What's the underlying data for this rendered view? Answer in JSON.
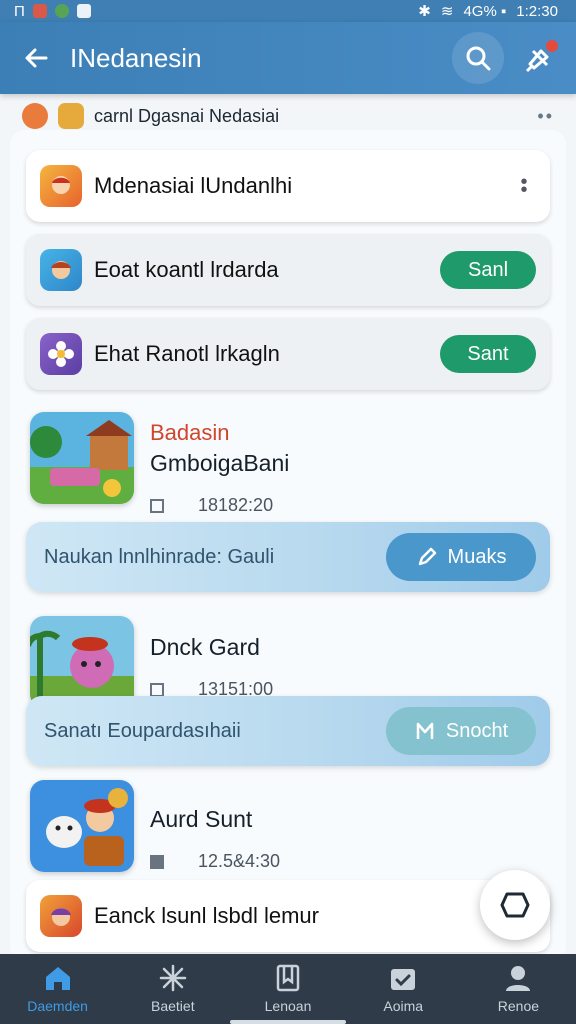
{
  "status_bar": {
    "left_text": "Π",
    "right_text": "4G% ▪",
    "time": "1:2:30"
  },
  "app_bar": {
    "title": "INedanesin",
    "icons": [
      "back-arrow-icon",
      "search-icon",
      "notification-icon"
    ]
  },
  "header": {
    "text": "carnl Dgasnai Nedasiai"
  },
  "list_cards": [
    {
      "title": "Mdenasiai lUndanlhi",
      "action": "menu"
    },
    {
      "title": "Eoat koantl lrdarda",
      "button": "Sanl"
    },
    {
      "title": "Ehat Ranotl lrkagln",
      "button": "Sant"
    }
  ],
  "features": [
    {
      "badge": "Badasin",
      "title": "GmboigaBani",
      "meta": "18182:20"
    },
    {
      "badge": "",
      "title": "Dnck Gard",
      "meta": "13151:00"
    },
    {
      "badge": "",
      "title": "Aurd Sunt",
      "meta": "12.5&4:30"
    }
  ],
  "banners": [
    {
      "text": "Naukan lnnlhinrade: Gauli",
      "button": "Muaks"
    },
    {
      "text": "Sanatı Eoupardasıhaii",
      "button": "Snocht"
    }
  ],
  "bottom_card": {
    "title": "Eanck lsunl lsbdl lemur"
  },
  "bottom_nav": {
    "items": [
      {
        "label": "Daemden",
        "icon": "home-icon",
        "active": true
      },
      {
        "label": "Baetiet",
        "icon": "sparkle-icon",
        "active": false
      },
      {
        "label": "Lenoan",
        "icon": "book-icon",
        "active": false
      },
      {
        "label": "Aoima",
        "icon": "calendar-check-icon",
        "active": false
      },
      {
        "label": "Renoe",
        "icon": "person-icon",
        "active": false
      }
    ]
  },
  "colors": {
    "app_bar": "#3c7fb6",
    "accent_green": "#1f9a6a",
    "banner_button": "#4a97cc",
    "bottom_nav": "#2f3b48",
    "active_nav": "#3f9be6"
  }
}
